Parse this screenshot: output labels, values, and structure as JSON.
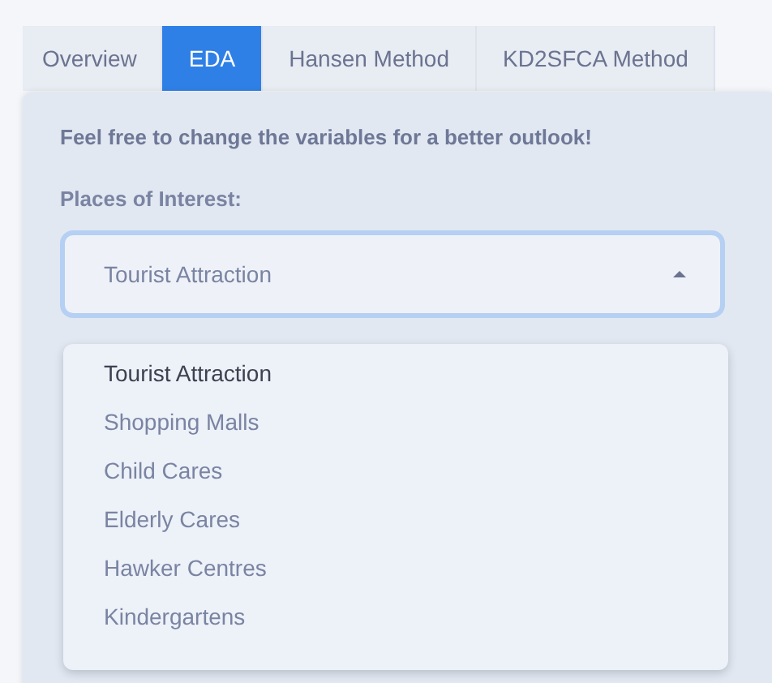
{
  "tabs": [
    {
      "label": "Overview",
      "selected": false
    },
    {
      "label": "EDA",
      "selected": true
    },
    {
      "label": "Hansen Method",
      "selected": false
    },
    {
      "label": "KD2SFCA Method",
      "selected": false
    }
  ],
  "intro": "Feel free to change the variables for a better outlook!",
  "select": {
    "label": "Places of Interest:",
    "value": "Tourist Attraction",
    "expanded": true,
    "options": [
      {
        "label": "Tourist Attraction",
        "selected": true
      },
      {
        "label": "Shopping Malls",
        "selected": false
      },
      {
        "label": "Child Cares",
        "selected": false
      },
      {
        "label": "Elderly Cares",
        "selected": false
      },
      {
        "label": "Hawker Centres",
        "selected": false
      },
      {
        "label": "Kindergartens",
        "selected": false
      }
    ]
  }
}
